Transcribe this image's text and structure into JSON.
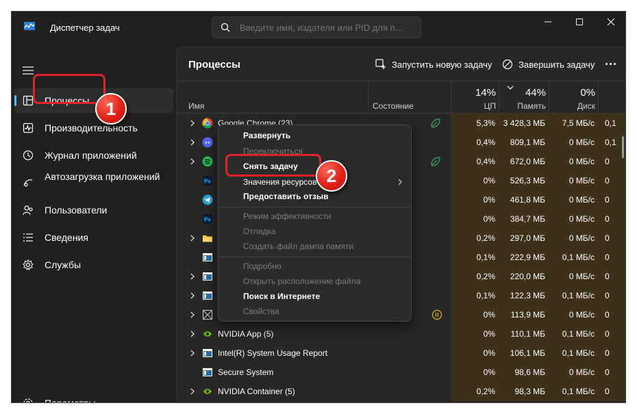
{
  "window": {
    "title": "Диспетчер задач",
    "search_placeholder": "Введите имя, издателя или PID для п..."
  },
  "sidebar": {
    "items": [
      {
        "label": "Процессы",
        "icon": "processes-icon"
      },
      {
        "label": "Производительность",
        "icon": "performance-icon"
      },
      {
        "label": "Журнал приложений",
        "icon": "history-icon"
      },
      {
        "label": "Автозагрузка приложений",
        "icon": "startup-icon"
      },
      {
        "label": "Пользователи",
        "icon": "users-icon"
      },
      {
        "label": "Сведения",
        "icon": "details-icon"
      },
      {
        "label": "Службы",
        "icon": "services-icon"
      }
    ],
    "settings_label": "Параметры"
  },
  "main": {
    "title": "Процессы",
    "run_task_label": "Запустить новую задачу",
    "end_task_label": "Завершить задачу"
  },
  "table": {
    "col_name": "Имя",
    "col_status": "Состояние",
    "cpu_pct": "14%",
    "cpu_label": "ЦП",
    "mem_pct": "44%",
    "mem_label": "Память",
    "disk_pct": "0%",
    "disk_label": "Диск",
    "rows": [
      {
        "name": "Google Chrome (23)",
        "cpu": "5,3%",
        "mem": "3 428,3 МБ",
        "disk": "7,5 МБ/с",
        "net": "0,1"
      },
      {
        "name": "",
        "cpu": "0,4%",
        "mem": "809,1 МБ",
        "disk": "0 МБ/с",
        "net": "0,1"
      },
      {
        "name": "",
        "cpu": "0,4%",
        "mem": "672,0 МБ",
        "disk": "0 МБ/с",
        "net": "0"
      },
      {
        "name": "",
        "cpu": "0%",
        "mem": "526,3 МБ",
        "disk": "0 МБ/с",
        "net": "0"
      },
      {
        "name": "",
        "cpu": "0%",
        "mem": "461,8 МБ",
        "disk": "0 МБ/с",
        "net": "0"
      },
      {
        "name": "",
        "cpu": "0%",
        "mem": "384,7 МБ",
        "disk": "0 МБ/с",
        "net": "0"
      },
      {
        "name": "",
        "cpu": "0,2%",
        "mem": "297,0 МБ",
        "disk": "0 МБ/с",
        "net": "0"
      },
      {
        "name": "",
        "cpu": "0,1%",
        "mem": "222,9 МБ",
        "disk": "0,1 МБ/с",
        "net": "0"
      },
      {
        "name": "",
        "cpu": "0,2%",
        "mem": "220,0 МБ",
        "disk": "0 МБ/с",
        "net": "0"
      },
      {
        "name": "",
        "cpu": "0,1%",
        "mem": "122,3 МБ",
        "disk": "0,1 МБ/с",
        "net": "0"
      },
      {
        "name": "",
        "cpu": "0%",
        "mem": "113,9 МБ",
        "disk": "0 МБ/с",
        "net": "0"
      },
      {
        "name": "NVIDIA App (5)",
        "cpu": "0%",
        "mem": "110,1 МБ",
        "disk": "0,1 МБ/с",
        "net": "0"
      },
      {
        "name": "Intel(R) System Usage Report",
        "cpu": "0%",
        "mem": "106,1 МБ",
        "disk": "0,1 МБ/с",
        "net": "0"
      },
      {
        "name": "Secure System",
        "cpu": "0%",
        "mem": "98,6 МБ",
        "disk": "0 МБ/с",
        "net": "0"
      },
      {
        "name": "NVIDIA Container (5)",
        "cpu": "0,2%",
        "mem": "98,3 МБ",
        "disk": "0,1 МБ/с",
        "net": "0"
      }
    ]
  },
  "context_menu": {
    "expand": "Развернуть",
    "switch": "Переключиться",
    "end_task": "Снять задачу",
    "resource_values": "Значения ресурсов",
    "feedback": "Предоставить отзыв",
    "efficiency": "Режим эффективности",
    "debug": "Отладка",
    "dump": "Создать файл дампа памяти",
    "details": "Подробно",
    "open_location": "Открыть расположение файла",
    "search_online": "Поиск в Интернете",
    "properties": "Свойства"
  },
  "annotations": {
    "badge1": "1",
    "badge2": "2"
  },
  "colors": {
    "accent": "#4cc2ff",
    "highlight_cells": "#3c3119",
    "annotation_red": "#e0232b"
  }
}
